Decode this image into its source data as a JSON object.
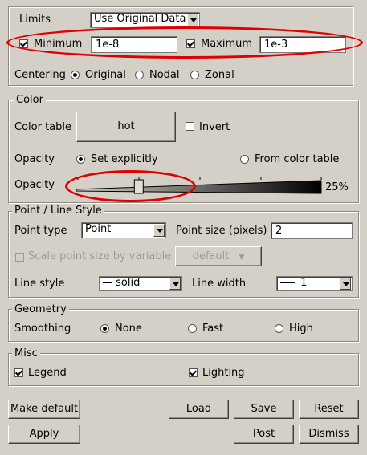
{
  "limits": {
    "label": "Limits",
    "mode_value": "Use Original Data",
    "minimum_label": "Minimum",
    "minimum_checked": true,
    "minimum_value": "1e-8",
    "maximum_label": "Maximum",
    "maximum_checked": true,
    "maximum_value": "1e-3"
  },
  "centering": {
    "label": "Centering",
    "options": [
      "Original",
      "Nodal",
      "Zonal"
    ],
    "selected": "Original"
  },
  "color": {
    "title": "Color",
    "color_table_label": "Color table",
    "color_table_value": "hot",
    "invert_label": "Invert",
    "invert_checked": false,
    "opacity_label": "Opacity",
    "opacity_mode_options": [
      "Set explicitly",
      "From color table"
    ],
    "opacity_mode_selected": "Set explicitly",
    "opacity_slider_label": "Opacity",
    "opacity_value_text": "25%",
    "opacity_fraction": 0.25
  },
  "point_line": {
    "title": "Point / Line Style",
    "point_type_label": "Point type",
    "point_type_value": "Point",
    "point_size_label": "Point size (pixels)",
    "point_size_value": "2",
    "scale_label": "Scale point size by variable",
    "scale_checked": false,
    "scale_variable_value": "default",
    "line_style_label": "Line style",
    "line_style_value": "solid",
    "line_width_label": "Line width",
    "line_width_value": "1"
  },
  "geometry": {
    "title": "Geometry",
    "smoothing_label": "Smoothing",
    "options": [
      "None",
      "Fast",
      "High"
    ],
    "selected": "None"
  },
  "misc": {
    "title": "Misc",
    "legend_label": "Legend",
    "legend_checked": true,
    "lighting_label": "Lighting",
    "lighting_checked": true
  },
  "buttons": {
    "make_default": "Make default",
    "load": "Load",
    "save": "Save",
    "reset": "Reset",
    "apply": "Apply",
    "post": "Post",
    "dismiss": "Dismiss"
  },
  "annotation_color": "#e00000"
}
